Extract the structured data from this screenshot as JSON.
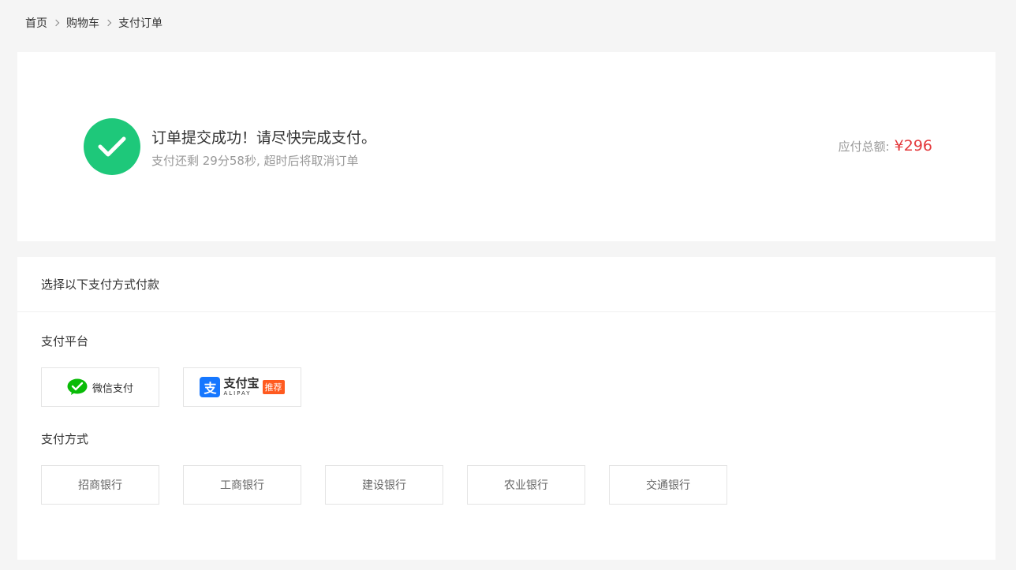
{
  "breadcrumb": {
    "items": [
      "首页",
      "购物车",
      "支付订单"
    ]
  },
  "success": {
    "title": "订单提交成功！请尽快完成支付。",
    "subtitle": "支付还剩 29分58秒, 超时后将取消订单",
    "total_label": "应付总额:",
    "total_value": "¥296",
    "icon": "check-icon"
  },
  "payment": {
    "header": "选择以下支付方式付款",
    "platform_title": "支付平台",
    "platforms": {
      "wechat": {
        "label": "微信支付",
        "icon": "wechat-icon"
      },
      "alipay": {
        "label": "支付宝",
        "sub": "ALIPAY",
        "badge": "推荐",
        "icon": "alipay-icon",
        "logo_glyph": "支"
      }
    },
    "method_title": "支付方式",
    "banks": [
      "招商银行",
      "工商银行",
      "建设银行",
      "农业银行",
      "交通银行"
    ]
  },
  "colors": {
    "success_green": "#1ec87a",
    "price_red": "#e4393c",
    "alipay_blue": "#1677ff",
    "wechat_green": "#09bb07",
    "badge_orange": "#ff5a1f"
  }
}
